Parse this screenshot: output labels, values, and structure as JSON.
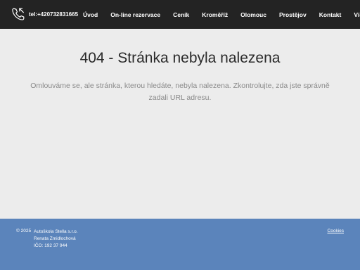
{
  "header": {
    "phone_label": "tel:+420732831665",
    "phone_icon": "phone-icon",
    "nav": [
      {
        "label": "Úvod"
      },
      {
        "label": "On-line rezervace"
      },
      {
        "label": "Ceník"
      },
      {
        "label": "Kroměříž"
      },
      {
        "label": "Olomouc"
      },
      {
        "label": "Prostějov"
      },
      {
        "label": "Kontakt"
      },
      {
        "label": "Více"
      }
    ]
  },
  "main": {
    "title": "404 - Stránka nebyla nalezena",
    "message": "Omlouváme se, ale stránka, kterou hledáte, nebyla nalezena. Zkontrolujte, zda jste správně zadali URL adresu."
  },
  "footer": {
    "copyright": "© 2025",
    "company_name": "Autoškola Stella s.r.o.",
    "owner": "Renata Zmidlochová",
    "ico": "IČO: 192 37 944",
    "cookies_label": "Cookies"
  },
  "colors": {
    "header_bg": "#232323",
    "page_bg": "#ececec",
    "footer_bg": "#5b84bb"
  }
}
